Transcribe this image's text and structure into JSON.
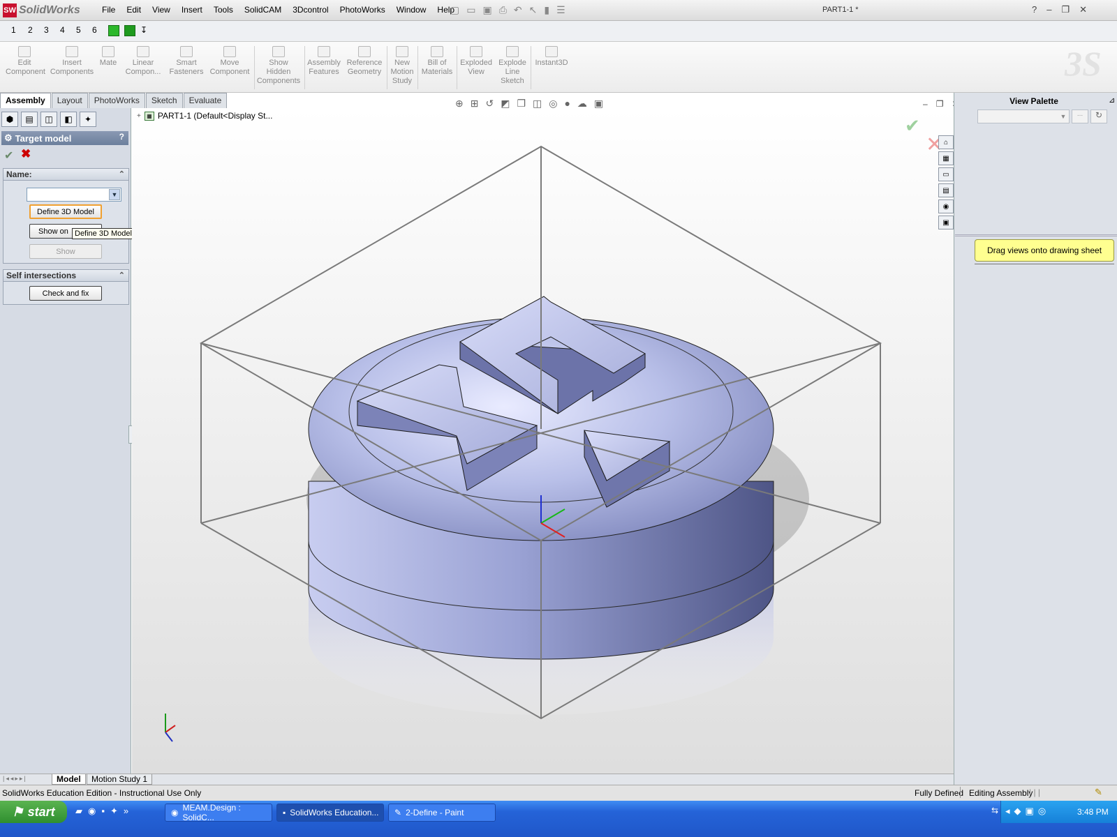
{
  "app": {
    "brand": "SolidWorks",
    "document_title": "PART1-1 *"
  },
  "menu": [
    "File",
    "Edit",
    "View",
    "Insert",
    "Tools",
    "SolidCAM",
    "3Dcontrol",
    "PhotoWorks",
    "Window",
    "Help"
  ],
  "title_help": "?",
  "command_manager": [
    {
      "label": "Edit\nComponent",
      "icon": "edit-component-icon"
    },
    {
      "label": "Insert\nComponents",
      "icon": "insert-components-icon"
    },
    {
      "label": "Mate",
      "icon": "mate-icon"
    },
    {
      "label": "Linear\nCompon...",
      "icon": "linear-pattern-icon"
    },
    {
      "label": "Smart\nFasteners",
      "icon": "smart-fasteners-icon"
    },
    {
      "label": "Move\nComponent",
      "icon": "move-component-icon"
    },
    {
      "label": "Show\nHidden\nComponents",
      "icon": "show-hidden-icon"
    },
    {
      "label": "Assembly\nFeatures",
      "icon": "assembly-features-icon"
    },
    {
      "label": "Reference\nGeometry",
      "icon": "reference-geometry-icon"
    },
    {
      "label": "New\nMotion\nStudy",
      "icon": "motion-study-icon"
    },
    {
      "label": "Bill of\nMaterials",
      "icon": "bom-icon"
    },
    {
      "label": "Exploded\nView",
      "icon": "exploded-view-icon"
    },
    {
      "label": "Explode\nLine\nSketch",
      "icon": "explode-line-icon"
    },
    {
      "label": "Instant3D",
      "icon": "instant3d-icon"
    }
  ],
  "tabs": [
    "Assembly",
    "Layout",
    "PhotoWorks",
    "Sketch",
    "Evaluate"
  ],
  "active_tab": "Assembly",
  "property_manager": {
    "title": "Target model",
    "help": "?",
    "name_group": {
      "header": "Name:",
      "select_value": "",
      "define_button": "Define 3D Model",
      "show_on_button": "Show on",
      "show_button": "Show",
      "tooltip": "Define 3D Model"
    },
    "self_intersections": {
      "header": "Self intersections",
      "check_button": "Check and fix"
    }
  },
  "tree": {
    "root": "PART1-1  (Default<Display St..."
  },
  "view_palette": {
    "title": "View Palette",
    "hint": "Drag views onto drawing sheet",
    "more_button": "..."
  },
  "bottom_tabs": [
    "Model",
    "Motion Study 1"
  ],
  "status": {
    "left": "SolidWorks Education Edition - Instructional Use Only",
    "fully_defined": "Fully Defined",
    "editing": "Editing Assembly",
    "bars": "| | |"
  },
  "taskbar": {
    "start": "start",
    "tasks": [
      "MEAM.Design : SolidC...",
      "SolidWorks Education...",
      "2-Define - Paint"
    ],
    "clock": "3:48 PM"
  },
  "colors": {
    "model_base": "#b8bfe8",
    "model_shadow": "#7a80b2",
    "model_highlight": "#eef0ff",
    "bbox_line": "#7a7a7a",
    "hint_bg": "#ffff90"
  }
}
